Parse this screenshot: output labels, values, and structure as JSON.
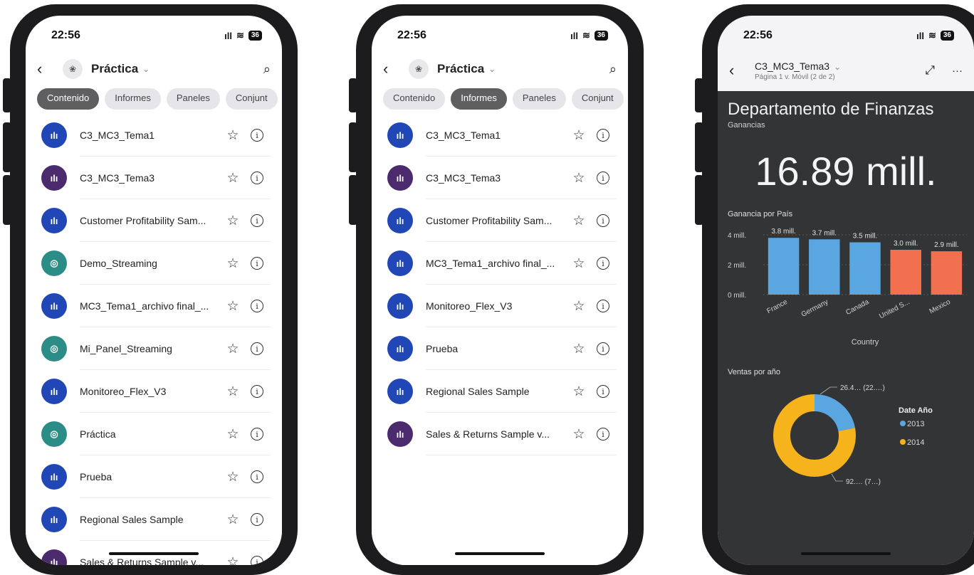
{
  "phone1": {
    "status": {
      "time": "22:56",
      "signal": "ıll",
      "wifi": "≋",
      "battery": "36"
    },
    "workspace": {
      "title": "Práctica"
    },
    "tabs": [
      {
        "label": "Contenido",
        "active": true
      },
      {
        "label": "Informes",
        "active": false
      },
      {
        "label": "Paneles",
        "active": false
      },
      {
        "label": "Conjunt",
        "active": false
      }
    ],
    "items": [
      {
        "name": "C3_MC3_Tema1",
        "type": "report"
      },
      {
        "name": "C3_MC3_Tema3",
        "type": "secure"
      },
      {
        "name": "Customer Profitability Sam...",
        "type": "report"
      },
      {
        "name": "Demo_Streaming",
        "type": "dash"
      },
      {
        "name": "MC3_Tema1_archivo final_...",
        "type": "report"
      },
      {
        "name": "Mi_Panel_Streaming",
        "type": "dash"
      },
      {
        "name": "Monitoreo_Flex_V3",
        "type": "report"
      },
      {
        "name": "Práctica",
        "type": "dash"
      },
      {
        "name": "Prueba",
        "type": "report"
      },
      {
        "name": "Regional Sales Sample",
        "type": "report"
      },
      {
        "name": "Sales & Returns Sample v...",
        "type": "secure"
      }
    ]
  },
  "phone2": {
    "status": {
      "time": "22:56",
      "signal": "ıll",
      "wifi": "≋",
      "battery": "36"
    },
    "workspace": {
      "title": "Práctica"
    },
    "tabs": [
      {
        "label": "Contenido",
        "active": false
      },
      {
        "label": "Informes",
        "active": true
      },
      {
        "label": "Paneles",
        "active": false
      },
      {
        "label": "Conjunt",
        "active": false
      }
    ],
    "items": [
      {
        "name": "C3_MC3_Tema1",
        "type": "report"
      },
      {
        "name": "C3_MC3_Tema3",
        "type": "secure"
      },
      {
        "name": "Customer Profitability Sam...",
        "type": "report"
      },
      {
        "name": "MC3_Tema1_archivo final_...",
        "type": "report"
      },
      {
        "name": "Monitoreo_Flex_V3",
        "type": "report"
      },
      {
        "name": "Prueba",
        "type": "report"
      },
      {
        "name": "Regional Sales Sample",
        "type": "report"
      },
      {
        "name": "Sales & Returns Sample v...",
        "type": "secure"
      }
    ]
  },
  "phone3": {
    "status": {
      "time": "22:56",
      "signal": "ıll",
      "wifi": "≋",
      "battery": "36"
    },
    "report": {
      "title": "C3_MC3_Tema3",
      "page": "Página 1 v. Móvil (2 de 2)"
    },
    "canvas": {
      "heading": "Departamento de Finanzas",
      "kpi_label": "Ganancias",
      "kpi_value": "16.89 mill."
    }
  },
  "chart_data": [
    {
      "type": "bar",
      "title": "Ganancia por País",
      "xlabel": "Country",
      "ylabel": "",
      "categories": [
        "France",
        "Germany",
        "Canada",
        "United S...",
        "Mexico"
      ],
      "values": [
        3.8,
        3.7,
        3.5,
        3.0,
        2.9
      ],
      "data_labels": [
        "3.8 mill.",
        "3.7 mill.",
        "3.5 mill.",
        "3.0 mill.",
        "2.9 mill."
      ],
      "colors": [
        "#5aa6e0",
        "#5aa6e0",
        "#5aa6e0",
        "#f2704f",
        "#f2704f"
      ],
      "yticks": [
        "0 mill.",
        "2 mill.",
        "4 mill."
      ],
      "ylim": [
        0,
        4
      ]
    },
    {
      "type": "pie",
      "title": "Ventas por año",
      "legend_title": "Date Año",
      "series": [
        {
          "name": "2013",
          "value": 22,
          "label": "26.4… (22.…)",
          "color": "#5aa6e0"
        },
        {
          "name": "2014",
          "value": 78,
          "label": "92.… (7…)",
          "color": "#f6b31c"
        }
      ]
    }
  ]
}
